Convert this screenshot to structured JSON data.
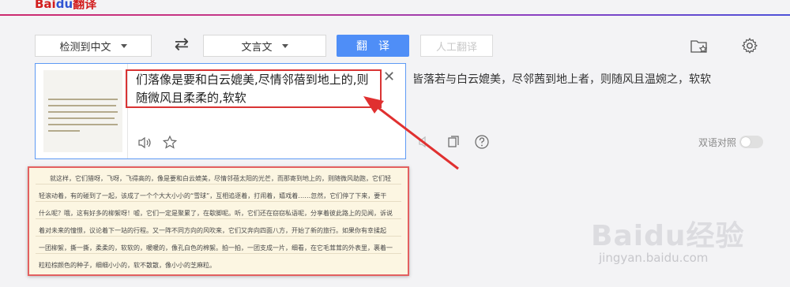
{
  "app": {
    "logo_text": "Bai",
    "logo_du": "du",
    "logo_suffix": "翻译"
  },
  "toolbar": {
    "source_lang": "检测到中文",
    "target_lang": "文言文",
    "translate_label": "翻译",
    "human_translate_label": "人工翻译",
    "swap_icon": "swap-arrows-icon",
    "favorites_icon": "folder-star-icon",
    "settings_icon": "gear-icon"
  },
  "input": {
    "text": "们落像是要和白云媲美,尽情邻蓓到地上的,则随微风且柔柔的,软软",
    "icons": [
      "speaker-icon",
      "star-icon",
      "close-icon"
    ]
  },
  "output": {
    "text": "皆落若与白云媲美，尽邻茜到地上者，则随风且温婉之，软软",
    "dual_label": "双语对照",
    "dual_enabled": false
  },
  "document": {
    "lines": [
      "就这样，它们猎呀，飞呀，飞得高的，像是要和白云媲美，尽情邻蓓太阳的光芒，而那寄到地上的，则随微风助跑，它们轻",
      "轻滚动着，有的碰到了一起，该成了一个个大大小小的“雪球”，互相追逐着，打闹着，嬉戏着……忽然，它们停了下来，要干",
      "什么呢？哦，这有好多的柳絮呀！嘘，它们一定是聚累了，在歇脚呢。听，它们还在窃窃私语呢，分享着彼此路上的见闻，诉说",
      "着对未来的憧憬，议论着下一站的行程。又一阵不同方向的风吹来，它们又奔向四面八方，开始了新的旅行。如果你有幸揉起",
      "一团柳絮，撕一撕，柔柔的，软软的，暖暖的，像孔白色的棉絮。拍一拍，一团支成一片，细看，在它毛茸茸的外表里，裹着一",
      "粒粒棕颜色的种子，细细小小的，软不散散，像小小的芝麻粒。"
    ]
  },
  "watermark": {
    "logo": "Baidu经验",
    "url": "jingyan.baidu.com"
  }
}
